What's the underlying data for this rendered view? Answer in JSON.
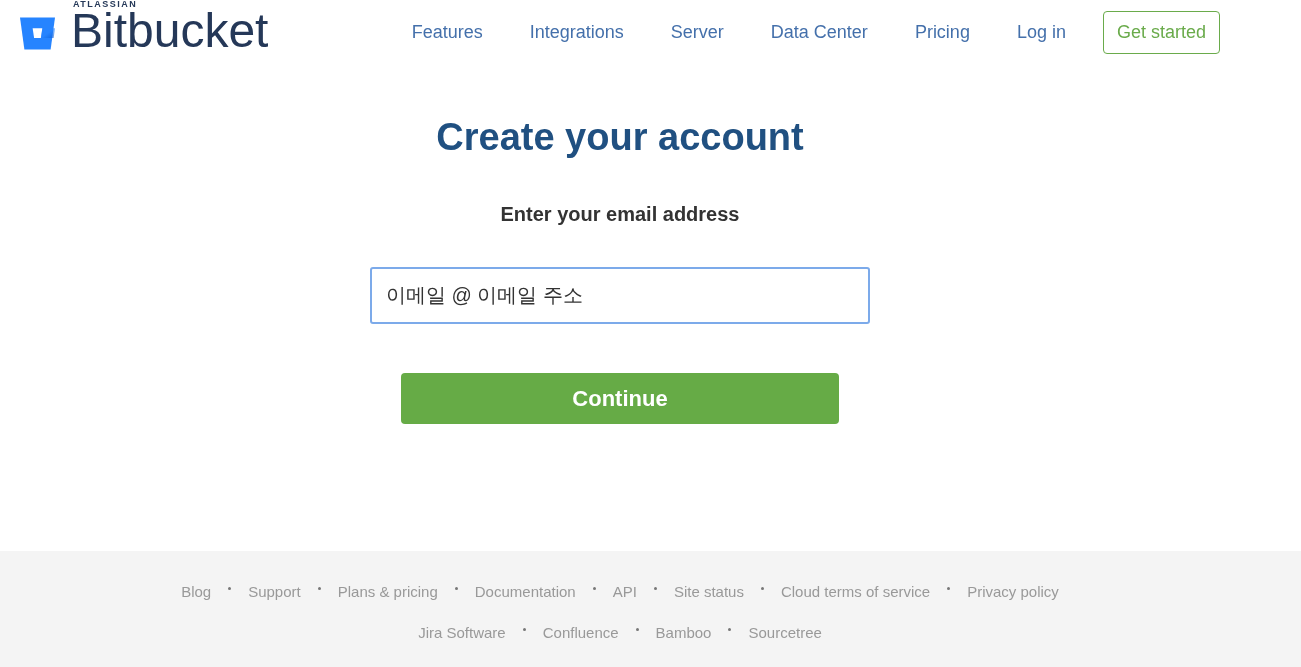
{
  "logo": {
    "overline": "ATLASSIAN",
    "wordmark": "Bitbucket"
  },
  "nav": {
    "links": [
      "Features",
      "Integrations",
      "Server",
      "Data Center",
      "Pricing",
      "Log in"
    ],
    "cta": "Get started"
  },
  "form": {
    "title": "Create your account",
    "label": "Enter your email address",
    "email_field": {
      "value": "이메일 @ 이메일 주소",
      "focused": true
    },
    "submit": "Continue"
  },
  "footer": {
    "links": [
      "Blog",
      "Support",
      "Plans & pricing",
      "Documentation",
      "API",
      "Site status",
      "Cloud terms of service",
      "Privacy policy"
    ],
    "products": [
      "Jira Software",
      "Confluence",
      "Bamboo",
      "Sourcetree"
    ]
  }
}
